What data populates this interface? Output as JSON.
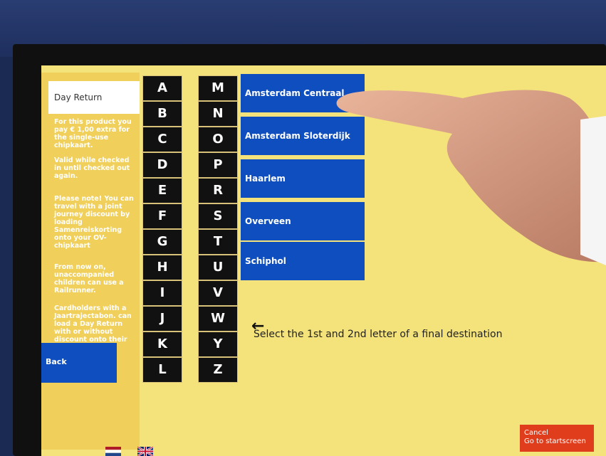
{
  "product": {
    "label": "Day Return"
  },
  "info": [
    "For this product you pay € 1,00 extra for the single-use chipkaart.",
    "Valid while checked in until checked out again.",
    "Please note! You can travel with a joint journey discount by loading Samenreiskorting onto your OV-chipkaart",
    "From now on, unaccompanied children can use a Railrunner.",
    "Cardholders with a Jaartrajectabon. can load a Day Return with or without discount onto their OV-chipkaart."
  ],
  "letters_left": [
    "A",
    "B",
    "C",
    "D",
    "E",
    "F",
    "G",
    "H",
    "I",
    "J",
    "K",
    "L"
  ],
  "letters_right": [
    "M",
    "N",
    "O",
    "P",
    "R",
    "S",
    "T",
    "U",
    "V",
    "W",
    "Y",
    "Z"
  ],
  "destinations": [
    "Amsterdam Centraal",
    "Amsterdam Sloterdijk",
    "Haarlem",
    "Overveen",
    "Schiphol"
  ],
  "instruction": "Select the 1st and 2nd letter of a final destination",
  "buttons": {
    "back": "Back",
    "cancel_line1": "Cancel",
    "cancel_line2": "Go to startscreen"
  },
  "colors": {
    "screen_bg": "#f4e27a",
    "button_blue": "#0f4ebf",
    "cancel_red": "#e03d1c",
    "letter_bg": "#111111"
  },
  "icons": [
    "left-arrow-icon",
    "dutch-flag-icon",
    "uk-flag-icon"
  ]
}
